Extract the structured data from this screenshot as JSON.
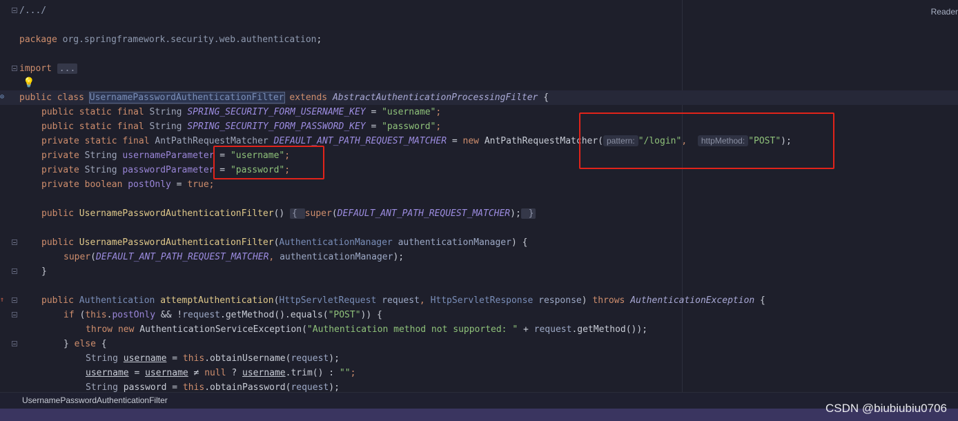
{
  "panel": {
    "reader_label": "Reader"
  },
  "code": {
    "l1": "/.../",
    "l2_kw": "package",
    "l2_pkg": "org.springframework.security.web.authentication",
    "l2_end": ";",
    "l3_kw": "import",
    "l3_fold": "...",
    "l4_kw": "public class ",
    "l4_name": "UsernamePasswordAuthenticationFilter",
    "l4_ext": " extends ",
    "l4_super": "AbstractAuthenticationProcessingFilter",
    "l4_end": " {",
    "l5_kw": "public static final ",
    "l5_ty": "String ",
    "l5_const": "SPRING_SECURITY_FORM_USERNAME_KEY",
    "l5_eq": " = ",
    "l5_str": "\"username\"",
    "l5_end": ";",
    "l6_kw": "public static final ",
    "l6_ty": "String ",
    "l6_const": "SPRING_SECURITY_FORM_PASSWORD_KEY",
    "l6_eq": " = ",
    "l6_str": "\"password\"",
    "l6_end": ";",
    "l7_kw": "private static final ",
    "l7_ty": "AntPathRequestMatcher ",
    "l7_const": "DEFAULT_ANT_PATH_REQUEST_MATCHER",
    "l7_eq": " = ",
    "l7_new": "new ",
    "l7_cls": "AntPathRequestMatcher(",
    "l7_hint1": "pattern:",
    "l7_str1": "\"/login\"",
    "l7_comma": ",  ",
    "l7_hint2": "httpMethod:",
    "l7_str2": "\"POST\"",
    "l7_end": ");",
    "l8_kw": "private ",
    "l8_ty": "String ",
    "l8_field": "usernameParameter",
    "l8_eq": " = ",
    "l8_str": "\"username\"",
    "l8_end": ";",
    "l9_kw": "private ",
    "l9_ty": "String ",
    "l9_field": "passwordParameter",
    "l9_eq": " = ",
    "l9_str": "\"password\"",
    "l9_end": ";",
    "l10_kw": "private boolean ",
    "l10_field": "postOnly",
    "l10_eq": " = ",
    "l10_val": "true",
    "l10_end": ";",
    "l11_kw": "public ",
    "l11_name": "UsernamePasswordAuthenticationFilter",
    "l11_paren": "() ",
    "l11_b1": "{ ",
    "l11_super": "super",
    "l11_open": "(",
    "l11_const": "DEFAULT_ANT_PATH_REQUEST_MATCHER",
    "l11_close": ");",
    "l11_b2": " }",
    "l12_kw": "public ",
    "l12_name": "UsernamePasswordAuthenticationFilter",
    "l12_open": "(",
    "l12_ty": "AuthenticationManager ",
    "l12_param": "authenticationManager",
    "l12_end": ") {",
    "l13_super": "super",
    "l13_open": "(",
    "l13_const": "DEFAULT_ANT_PATH_REQUEST_MATCHER",
    "l13_comma": ", ",
    "l13_param": "authenticationManager",
    "l13_end": ");",
    "l14": "}",
    "l15_kw": "public ",
    "l15_ty": "Authentication ",
    "l15_fn": "attemptAuthentication",
    "l15_open": "(",
    "l15_ty2": "HttpServletRequest ",
    "l15_p1": "request",
    "l15_comma": ", ",
    "l15_ty3": "HttpServletResponse ",
    "l15_p2": "response",
    "l15_close": ") ",
    "l15_throws": "throws ",
    "l15_exc": "AuthenticationException",
    "l15_end": " {",
    "l16_if": "if ",
    "l16_open": "(",
    "l16_this": "this",
    "l16_dot": ".",
    "l16_field": "postOnly",
    "l16_and": " && !",
    "l16_req": "request",
    "l16_call": ".getMethod().equals(",
    "l16_str": "\"POST\"",
    "l16_end": ")) {",
    "l17_throw": "throw new ",
    "l17_cls": "AuthenticationServiceException(",
    "l17_str": "\"Authentication method not supported: \"",
    "l17_plus": " + ",
    "l17_req": "request",
    "l17_end": ".getMethod());",
    "l18_b": "} ",
    "l18_else": "else",
    "l18_end": " {",
    "l19_ty": "String ",
    "l19_var": "username",
    "l19_eq": " = ",
    "l19_this": "this",
    "l19_call": ".obtainUsername(",
    "l19_req": "request",
    "l19_end": ");",
    "l20_var": "username",
    "l20_eq": " = ",
    "l20_var2": "username",
    "l20_ne": " ≠ ",
    "l20_null": "null",
    "l20_q": " ? ",
    "l20_var3": "username",
    "l20_trim": ".trim() : ",
    "l20_str": "\"\"",
    "l20_end": ";",
    "l21_ty": "String ",
    "l21_var": "password",
    "l21_eq": " = ",
    "l21_this": "this",
    "l21_call": ".obtainPassword(",
    "l21_req": "request",
    "l21_end": ");"
  },
  "statusbar": {
    "breadcrumb": "UsernamePasswordAuthenticationFilter"
  },
  "watermark": "CSDN @biubiubiu0706",
  "colors": {
    "background": "#1e1f2b",
    "highlight_box": "#e2231a",
    "bottom_bar": "#3a3560"
  }
}
